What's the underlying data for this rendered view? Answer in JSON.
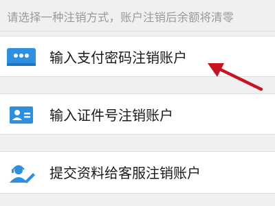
{
  "hint": {
    "text": "请选择一种注销方式，账户注销后余额将清零"
  },
  "options": [
    {
      "label": "输入支付密码注销账户",
      "icon": "password-keypad-icon"
    },
    {
      "label": "输入证件号注销账户",
      "icon": "id-card-icon"
    },
    {
      "label": "提交资料给客服注销账户",
      "icon": "customer-service-icon"
    }
  ],
  "colors": {
    "icon_blue": "#2d8fe0",
    "arrow_red": "#c8141e",
    "background": "#f0f0f2",
    "hint_text": "#9a9a9a"
  }
}
